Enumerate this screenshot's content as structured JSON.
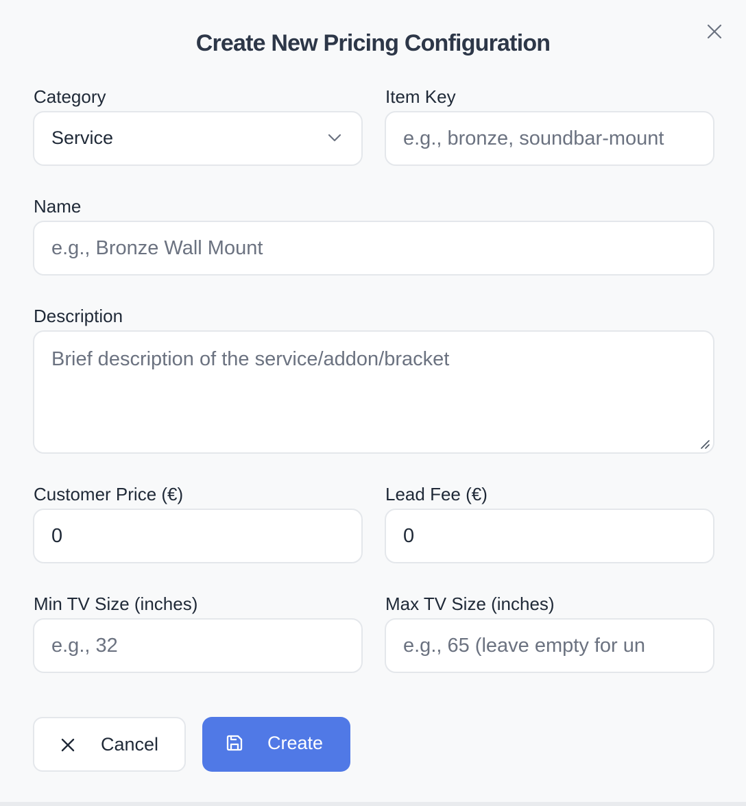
{
  "dialog": {
    "title": "Create New Pricing Configuration"
  },
  "fields": {
    "category": {
      "label": "Category",
      "value": "Service"
    },
    "item_key": {
      "label": "Item Key",
      "placeholder": "e.g., bronze, soundbar-mount"
    },
    "name": {
      "label": "Name",
      "placeholder": "e.g., Bronze Wall Mount"
    },
    "description": {
      "label": "Description",
      "placeholder": "Brief description of the service/addon/bracket"
    },
    "customer_price": {
      "label": "Customer Price (€)",
      "value": "0"
    },
    "lead_fee": {
      "label": "Lead Fee (€)",
      "value": "0"
    },
    "min_tv_size": {
      "label": "Min TV Size (inches)",
      "placeholder": "e.g., 32"
    },
    "max_tv_size": {
      "label": "Max TV Size (inches)",
      "placeholder": "e.g., 65 (leave empty for un"
    }
  },
  "buttons": {
    "cancel": "Cancel",
    "create": "Create"
  },
  "icons": {
    "close": "close-icon",
    "chevron": "chevron-down-icon",
    "cancel": "close-icon",
    "create": "save-icon"
  },
  "colors": {
    "primary": "#5079e6",
    "background": "#f8f9fa",
    "border": "#e4e7eb"
  }
}
